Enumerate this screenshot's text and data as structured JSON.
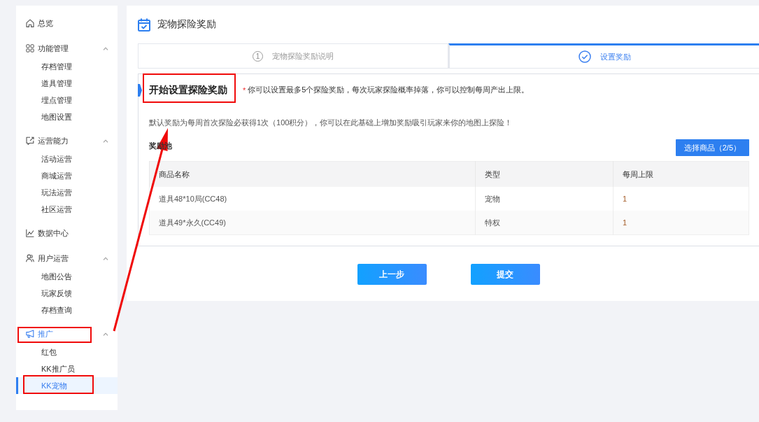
{
  "sidebar": {
    "items": [
      {
        "label": "总览",
        "annotated": false
      },
      {
        "label": "功能管理",
        "annotated": false,
        "expanded": true,
        "children": [
          {
            "label": "存档管理",
            "selected": false,
            "annotated": false
          },
          {
            "label": "道具管理",
            "selected": false,
            "annotated": false
          },
          {
            "label": "埋点管理",
            "selected": false,
            "annotated": false
          },
          {
            "label": "地图设置",
            "selected": false,
            "annotated": false
          }
        ]
      },
      {
        "label": "运营能力",
        "annotated": false,
        "expanded": true,
        "children": [
          {
            "label": "活动运营",
            "selected": false,
            "annotated": false
          },
          {
            "label": "商城运营",
            "selected": false,
            "annotated": false
          },
          {
            "label": "玩法运营",
            "selected": false,
            "annotated": false
          },
          {
            "label": "社区运营",
            "selected": false,
            "annotated": false
          }
        ]
      },
      {
        "label": "数据中心",
        "annotated": false
      },
      {
        "label": "用户运营",
        "annotated": false,
        "expanded": true,
        "children": [
          {
            "label": "地图公告",
            "selected": false,
            "annotated": false
          },
          {
            "label": "玩家反馈",
            "selected": false,
            "annotated": false
          },
          {
            "label": "存档查询",
            "selected": false,
            "annotated": false
          }
        ]
      },
      {
        "label": "推广",
        "annotated": true,
        "expanded": true,
        "children": [
          {
            "label": "红包",
            "selected": false,
            "annotated": false
          },
          {
            "label": "KK推广员",
            "selected": false,
            "annotated": false
          },
          {
            "label": "KK宠物",
            "selected": true,
            "annotated": true
          }
        ]
      }
    ]
  },
  "page_header": {
    "title": "宠物探险奖励"
  },
  "steps": [
    {
      "kind": "number",
      "number": "1",
      "label": "宠物探险奖励说明",
      "selected": false
    },
    {
      "kind": "check",
      "label": "设置奖励",
      "selected": true
    }
  ],
  "section": {
    "title": "开始设置探险奖励",
    "annotated": true,
    "note_mark": "*",
    "note": "你可以设置最多5个探险奖励，每次玩家探险概率掉落，你可以控制每周产出上限。",
    "description": "默认奖励为每周首次探险必获得1次（100积分），你可以在此基础上增加奖励吸引玩家来你的地图上探险！"
  },
  "reward_pool": {
    "title": "奖励池",
    "select_button": "选择商品（2/5）",
    "table": {
      "columns": [
        "商品名称",
        "类型",
        "每周上限"
      ],
      "rows": [
        [
          "道具48*10局(CC48)",
          "宠物",
          "1"
        ],
        [
          "道具49*永久(CC49)",
          "特权",
          "1"
        ]
      ]
    }
  },
  "actions": [
    "上一步",
    "提交"
  ]
}
